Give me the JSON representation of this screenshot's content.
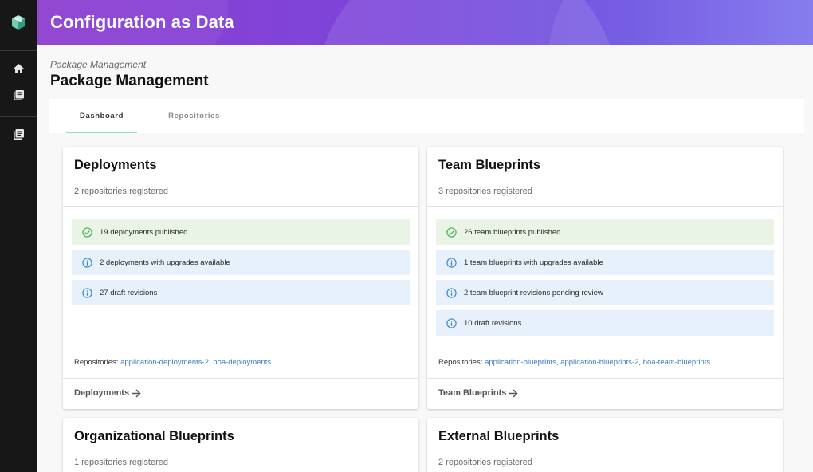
{
  "app": {
    "title": "Configuration as Data"
  },
  "breadcrumb": "Package Management",
  "page_title": "Package Management",
  "sidebar": {
    "items": [
      {
        "icon": "home-icon"
      },
      {
        "icon": "library-icon"
      },
      {
        "icon": "library-icon"
      }
    ]
  },
  "tabs": [
    {
      "label": "Dashboard",
      "active": true
    },
    {
      "label": "Repositories",
      "active": false
    }
  ],
  "colors": {
    "accent_tab": "#8fdccb",
    "success": "#4caf50",
    "info": "#3f86d6",
    "link": "#3f7ac6"
  },
  "cards": [
    {
      "title": "Deployments",
      "subtitle": "2 repositories registered",
      "stats": [
        {
          "type": "success",
          "text": "19 deployments published"
        },
        {
          "type": "info",
          "text": "2 deployments with upgrades available"
        },
        {
          "type": "info",
          "text": "27 draft revisions"
        }
      ],
      "repos_label": "Repositories:",
      "repos": [
        "application-deployments-2",
        "boa-deployments"
      ],
      "footer": "Deployments"
    },
    {
      "title": "Team Blueprints",
      "subtitle": "3 repositories registered",
      "stats": [
        {
          "type": "success",
          "text": "26 team blueprints published"
        },
        {
          "type": "info",
          "text": "1 team blueprints with upgrades available"
        },
        {
          "type": "info",
          "text": "2 team blueprint revisions pending review"
        },
        {
          "type": "info",
          "text": "10 draft revisions"
        }
      ],
      "repos_label": "Repositories:",
      "repos": [
        "application-blueprints",
        "application-blueprints-2",
        "boa-team-blueprints"
      ],
      "footer": "Team Blueprints"
    },
    {
      "title": "Organizational Blueprints",
      "subtitle": "1 repositories registered"
    },
    {
      "title": "External Blueprints",
      "subtitle": "2 repositories registered"
    }
  ]
}
